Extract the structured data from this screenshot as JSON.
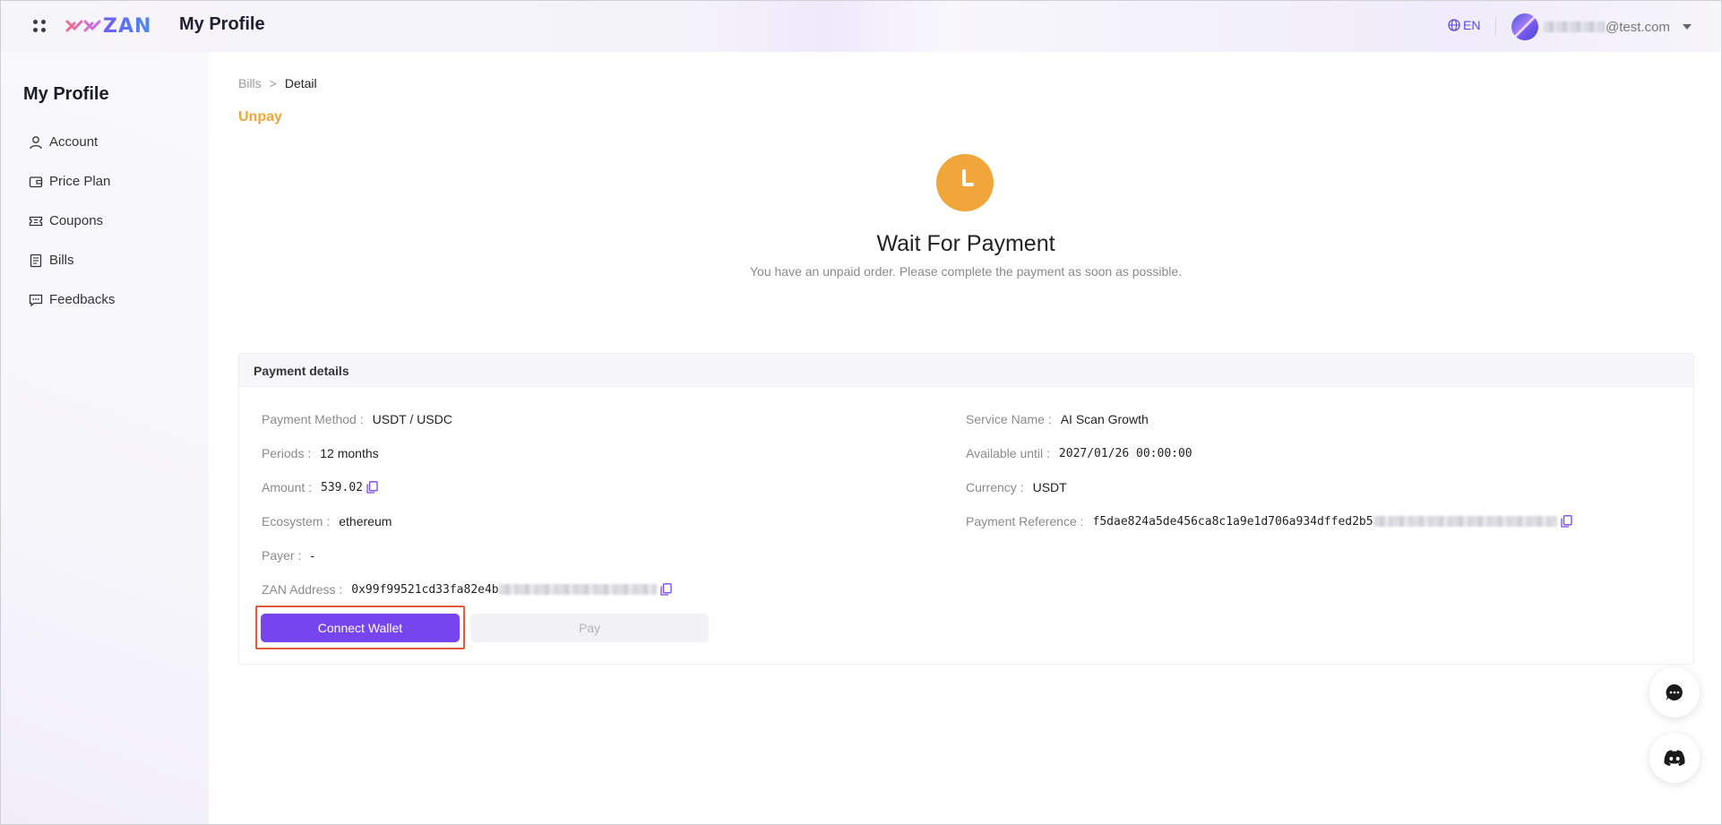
{
  "header": {
    "logo_text": "ZAN",
    "title": "My Profile",
    "language": "EN",
    "user_email_domain": "@test.com"
  },
  "sidebar": {
    "title": "My Profile",
    "items": [
      {
        "label": "Account",
        "icon": "user-icon"
      },
      {
        "label": "Price Plan",
        "icon": "wallet-icon"
      },
      {
        "label": "Coupons",
        "icon": "ticket-icon"
      },
      {
        "label": "Bills",
        "icon": "document-icon"
      },
      {
        "label": "Feedbacks",
        "icon": "message-icon"
      }
    ]
  },
  "breadcrumb": {
    "parent": "Bills",
    "separator": ">",
    "current": "Detail"
  },
  "status": "Unpay",
  "hero": {
    "title": "Wait For Payment",
    "subtitle": "You have an unpaid order. Please complete the payment as soon as possible."
  },
  "payment_details": {
    "title": "Payment details",
    "left": {
      "payment_method": {
        "label": "Payment Method :",
        "value": "USDT / USDC"
      },
      "periods": {
        "label": "Periods :",
        "value": "12 months"
      },
      "amount": {
        "label": "Amount :",
        "value": "539.02"
      },
      "ecosystem": {
        "label": "Ecosystem :",
        "value": "ethereum"
      },
      "payer": {
        "label": "Payer :",
        "value": "-"
      },
      "zan_address": {
        "label": "ZAN Address :",
        "value": "0x99f99521cd33fa82e4b"
      }
    },
    "right": {
      "service_name": {
        "label": "Service Name :",
        "value": "AI Scan Growth"
      },
      "available_until": {
        "label": "Available until :",
        "value": "2027/01/26 00:00:00"
      },
      "currency": {
        "label": "Currency :",
        "value": "USDT"
      },
      "payment_reference": {
        "label": "Payment Reference :",
        "value": "f5dae824a5de456ca8c1a9e1d706a934dffed2b5"
      }
    }
  },
  "actions": {
    "connect_wallet": "Connect Wallet",
    "pay": "Pay"
  },
  "colors": {
    "accent": "#7645f0",
    "warning": "#f0a63a",
    "highlight": "#e05a3c"
  }
}
